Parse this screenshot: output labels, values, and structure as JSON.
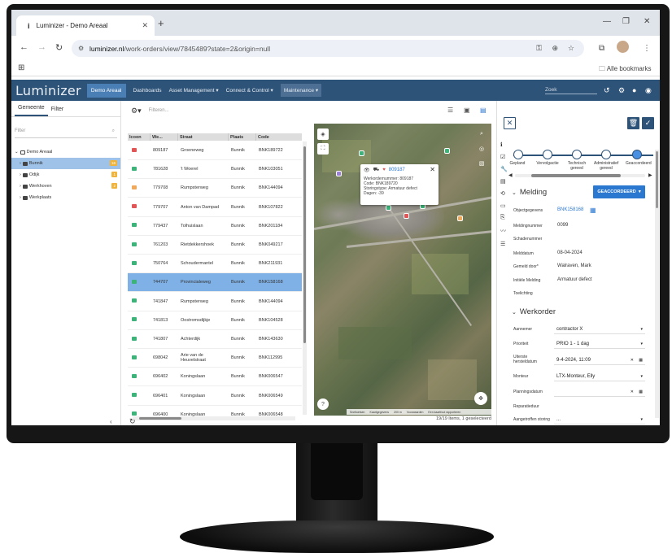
{
  "browser": {
    "tab_title": "Luminizer - Demo Areaal",
    "tab_favicon": "i",
    "new_tab": "+",
    "url_domain": "luminizer.nl",
    "url_path": "/work-orders/view/7845489?state=2&origin=null",
    "bookmarks_label": "Alle bookmarks"
  },
  "app": {
    "logo": "Luminizer",
    "areal": "Demo Areaal",
    "menu": [
      "Dashboards",
      "Asset Management ▾",
      "Connect & Control ▾",
      "Maintenance ▾"
    ],
    "search_placeholder": "Zoek"
  },
  "left": {
    "tab_gemeente": "Gemeente",
    "tab_filter": "Filter",
    "filter_placeholder": "Filter",
    "tree": [
      {
        "label": "Demo Areaal",
        "level": 0,
        "badge": ""
      },
      {
        "label": "Bunnik",
        "level": 1,
        "badge": "16",
        "selected": true
      },
      {
        "label": "Odijk",
        "level": 1,
        "badge": "1"
      },
      {
        "label": "Werkhoven",
        "level": 1,
        "badge": "2"
      },
      {
        "label": "Werkplaats",
        "level": 1,
        "badge": ""
      }
    ],
    "collapse": "‹"
  },
  "grid": {
    "filter_placeholder": "Filteren...",
    "columns": [
      "Icoon",
      "We...",
      "Straat",
      "Plaats",
      "Code"
    ],
    "rows": [
      {
        "color": "#e05555",
        "nr": "809187",
        "straat": "Groeneweg",
        "plaats": "Bunnik",
        "code": "BNK189722"
      },
      {
        "color": "#3db37a",
        "nr": "781628",
        "straat": "'t Woerel",
        "plaats": "Bunnik",
        "code": "BNK103051"
      },
      {
        "color": "#f0a85a",
        "nr": "779708",
        "straat": "Rumpsterweg",
        "plaats": "Bunnik",
        "code": "BNK144094"
      },
      {
        "color": "#e05555",
        "nr": "779707",
        "straat": "Anton van Dampad",
        "plaats": "Bunnik",
        "code": "BNK107822"
      },
      {
        "color": "#3db37a",
        "nr": "779437",
        "straat": "Tolhuislaan",
        "plaats": "Bunnik",
        "code": "BNK201184"
      },
      {
        "color": "#3db37a",
        "nr": "761203",
        "straat": "Rietdekkershoek",
        "plaats": "Bunnik",
        "code": "BNK049217"
      },
      {
        "color": "#3db37a",
        "nr": "750764",
        "straat": "Schoudermantel",
        "plaats": "Bunnik",
        "code": "BNK211931"
      },
      {
        "color": "#3db37a",
        "nr": "744707",
        "straat": "Provincialeweg",
        "plaats": "Bunnik",
        "code": "BNK158168",
        "selected": true
      },
      {
        "color": "#3db37a",
        "nr": "741847",
        "straat": "Rumpsterweg",
        "plaats": "Bunnik",
        "code": "BNK144094"
      },
      {
        "color": "#3db37a",
        "nr": "741813",
        "straat": "Oostromsdijkje",
        "plaats": "Bunnik",
        "code": "BNK104528"
      },
      {
        "color": "#3db37a",
        "nr": "741807",
        "straat": "Achterdijk",
        "plaats": "Bunnik",
        "code": "BNK143630"
      },
      {
        "color": "#3db37a",
        "nr": "698042",
        "straat": "Arie van de Heuvelstraat",
        "plaats": "Bunnik",
        "code": "BNK112995"
      },
      {
        "color": "#3db37a",
        "nr": "696402",
        "straat": "Koningslaan",
        "plaats": "Bunnik",
        "code": "BNK006547"
      },
      {
        "color": "#3db37a",
        "nr": "696401",
        "straat": "Koningslaan",
        "plaats": "Bunnik",
        "code": "BNK006549"
      },
      {
        "color": "#3db37a",
        "nr": "696400",
        "straat": "Koningslaan",
        "plaats": "Bunnik",
        "code": "BNK006548"
      }
    ],
    "footer": "19/19 Items, 1 geselecteerd"
  },
  "map": {
    "popup": {
      "id": "809187",
      "werkordernummer": "Werkordernummer: 809187",
      "code": "Code: BNK189720",
      "storingstype": "Storingstype: Armatuur defect",
      "dagen": "Dagen: -39"
    },
    "attribution": [
      "Sneltoetsen",
      "Kaartgegevens",
      "200 m",
      "Voorwaarden",
      "Een kaartfout rapporteren"
    ]
  },
  "detail": {
    "steps": [
      "Gepland",
      "Vervolgactie",
      "Technisch gereed",
      "Administratief gereed",
      "Geaccordeerd"
    ],
    "melding_title": "Melding",
    "status_button": "GEACCORDEERD",
    "fields": [
      {
        "label": "Objectgegevens",
        "value": "BNK158168"
      },
      {
        "label": "Meldingnummer",
        "value": "0099"
      },
      {
        "label": "Schadenummer",
        "value": ""
      },
      {
        "label": "Melddatum",
        "value": "08-04-2024"
      },
      {
        "label": "Gemeld door*",
        "value": "Walraven, Mark"
      },
      {
        "label": "Initiële Melding",
        "value": "Armatuur defect"
      },
      {
        "label": "Toelichting",
        "value": ""
      }
    ],
    "werkorder_title": "Werkorder",
    "werkorder": [
      {
        "label": "Aannemer",
        "value": "contractor X"
      },
      {
        "label": "Prioriteit",
        "value": "PRIO 1 - 1 dag"
      },
      {
        "label": "Uiterste hersteldatum",
        "value": "9-4-2024, 11:09"
      },
      {
        "label": "Monteur",
        "value": "LTX-Monteur, Elly"
      },
      {
        "label": "Planningsdatum",
        "value": ""
      },
      {
        "label": "Reparatieduur",
        "value": ""
      },
      {
        "label": "Aangetroffen storing",
        "value": "..."
      }
    ]
  },
  "colors": {
    "appbar": "#2e5378",
    "accent": "#2b78d1",
    "selected_row": "#7fb1e6"
  }
}
